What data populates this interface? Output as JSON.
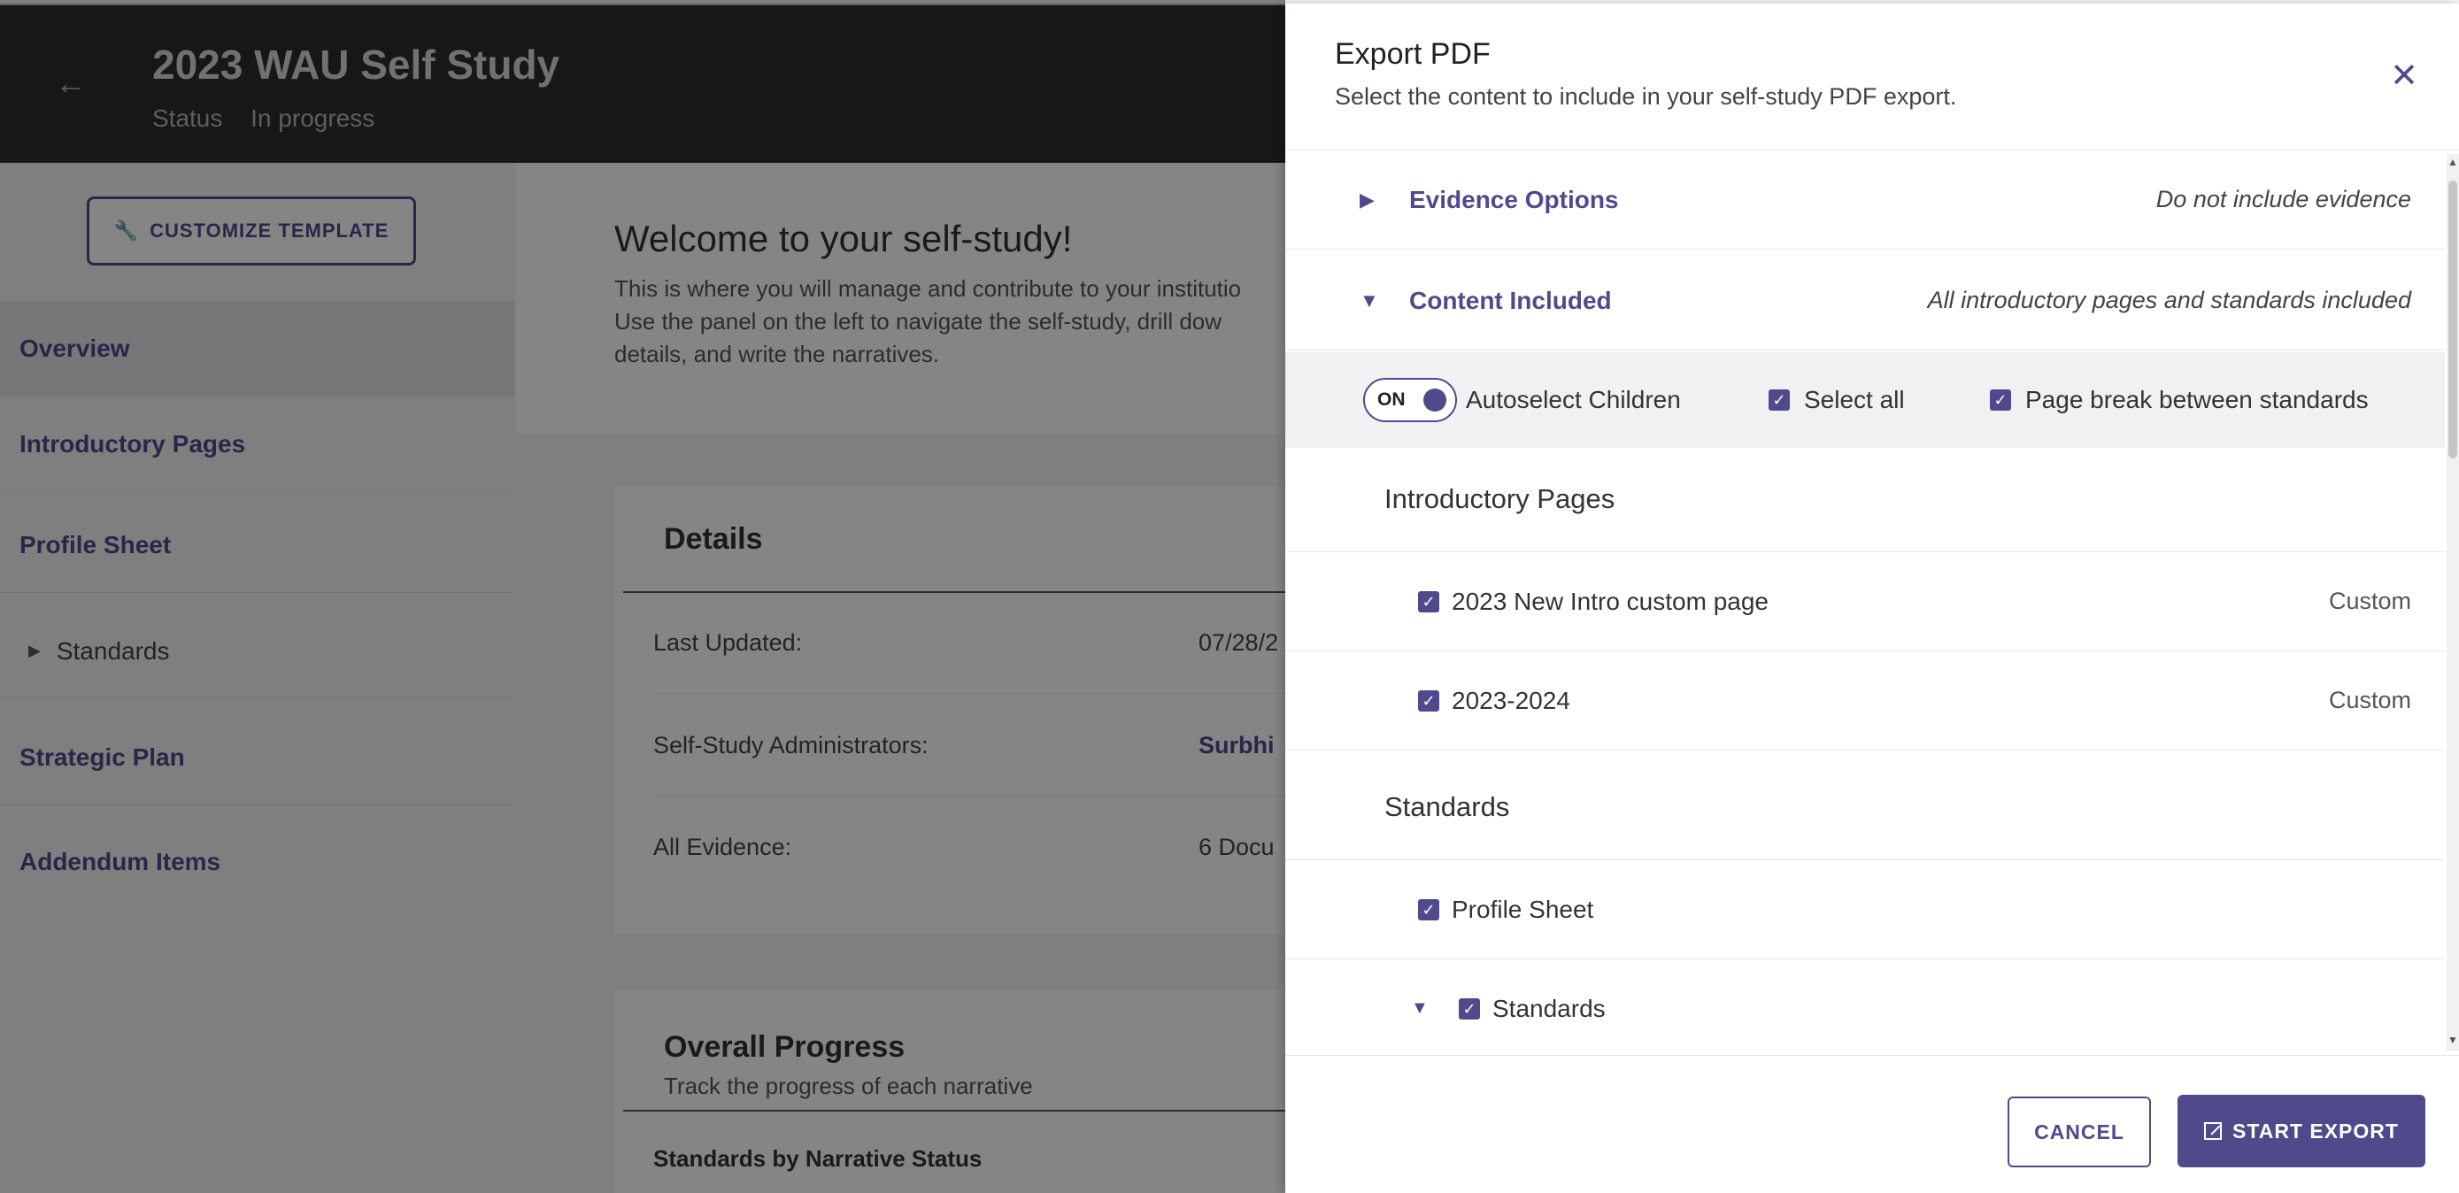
{
  "colors": {
    "accent": "#4f4a8c",
    "header_bg": "#2b2c30",
    "overlay": "rgba(0,0,0,0.48)"
  },
  "header": {
    "back_icon": "arrow-left-icon",
    "title": "2023 WAU Self Study",
    "status_label": "Status",
    "status_value": "In progress"
  },
  "sidebar": {
    "customize_icon": "wrench-icon",
    "customize_label": "CUSTOMIZE TEMPLATE",
    "items": [
      {
        "label": "Overview"
      },
      {
        "label": "Introductory Pages"
      },
      {
        "label": "Profile Sheet"
      },
      {
        "label": "Standards"
      },
      {
        "label": "Strategic Plan"
      },
      {
        "label": "Addendum Items"
      }
    ]
  },
  "main": {
    "welcome_title": "Welcome to your self-study!",
    "welcome_lines": [
      "This is where you will manage and contribute to your institutio",
      "Use the panel on the left to navigate the self-study, drill dow",
      "details, and write the narratives."
    ],
    "details": {
      "title": "Details",
      "rows": [
        {
          "label": "Last Updated:",
          "value": "07/28/2"
        },
        {
          "label": "Self-Study Administrators:",
          "value": "Surbhi"
        },
        {
          "label": "All Evidence:",
          "value": "6 Docu"
        }
      ]
    },
    "progress": {
      "title": "Overall Progress",
      "subtitle": "Track the progress of each narrative",
      "section_label": "Standards by Narrative Status"
    }
  },
  "drawer": {
    "title": "Export PDF",
    "subtitle": "Select the content to include in your self-study PDF export.",
    "close_icon": "close-icon",
    "sections": [
      {
        "label": "Evidence Options",
        "summary": "Do not include evidence",
        "expanded": false
      },
      {
        "label": "Content Included",
        "summary": "All introductory pages and standards included",
        "expanded": true
      }
    ],
    "toolbar": {
      "toggle_text": "ON",
      "autoselect_label": "Autoselect Children",
      "select_all_label": "Select all",
      "page_break_label": "Page break between standards"
    },
    "groups": {
      "intro_heading": "Introductory Pages",
      "intro_items": [
        {
          "label": "2023 New Intro custom page",
          "type": "Custom"
        },
        {
          "label": "2023-2024",
          "type": "Custom"
        }
      ],
      "standards_heading": "Standards",
      "standards_items": [
        {
          "label": "Profile Sheet"
        },
        {
          "label": "Standards"
        }
      ]
    },
    "footer": {
      "cancel_label": "CANCEL",
      "export_label": "START EXPORT",
      "export_icon": "external-link-icon"
    }
  }
}
